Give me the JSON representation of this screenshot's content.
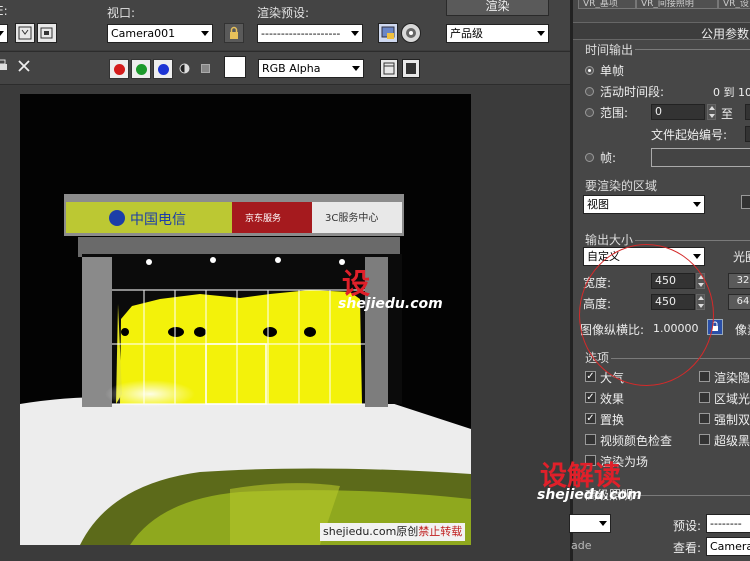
{
  "toolbar": {
    "viewport_label": "视口:",
    "viewport_value": "Camera001",
    "preset_label": "渲染预设:",
    "preset_value": "--------------------",
    "render_button": "渲染",
    "level_value": "产品级",
    "channel_value": "RGB Alpha",
    "left_cut_label": "E:"
  },
  "right_panel": {
    "tabs": [
      "VR_基项",
      "VR_间接照明",
      "VR_设"
    ],
    "common_params": "公用参数",
    "time_output": {
      "title": "时间输出",
      "single": "单帧",
      "active_segment": "活动时间段:",
      "active_range": "0 到 10",
      "range_label": "范围:",
      "range_from": "0",
      "range_to_label": "至",
      "file_start": "文件起始编号:",
      "frames_label": "帧:"
    },
    "area": {
      "title": "要渲染的区域",
      "value": "视图"
    },
    "output_size": {
      "title": "输出大小",
      "preset": "自定义",
      "aperture_cut": "光圈",
      "width_label": "宽度:",
      "width": "450",
      "height_label": "高度:",
      "height": "450",
      "preset_w_cut": "32",
      "preset_h_cut": "64",
      "aspect_label": "图像纵横比:",
      "aspect": "1.00000",
      "pixel_cut": "像素"
    },
    "options": {
      "title": "选项",
      "left": [
        {
          "label": "大气",
          "checked": true
        },
        {
          "label": "效果",
          "checked": true
        },
        {
          "label": "置换",
          "checked": true
        },
        {
          "label": "视频颜色检查",
          "checked": false
        },
        {
          "label": "渲染为场",
          "checked": false
        }
      ],
      "right": [
        {
          "label": "渲染隐",
          "checked": false
        },
        {
          "label": "区域光",
          "checked": false
        },
        {
          "label": "强制双",
          "checked": false
        },
        {
          "label": "超级黑",
          "checked": false
        }
      ]
    },
    "bottom": {
      "lighting": "高级照明",
      "preset_label": "预设:",
      "view_label": "查看:",
      "view_value": "Camera0",
      "left_cut": "ade"
    }
  },
  "render_image": {
    "sign_telecom": "中国电信",
    "sign_service": "京东服务",
    "sign_3c": "3C服务中心"
  },
  "watermarks": {
    "logo_text": "设",
    "logo_big": "设解读",
    "site": "shejiedu.com",
    "bottom_site": "shejiedu.com原创",
    "bottom_warn": "禁止转载"
  }
}
